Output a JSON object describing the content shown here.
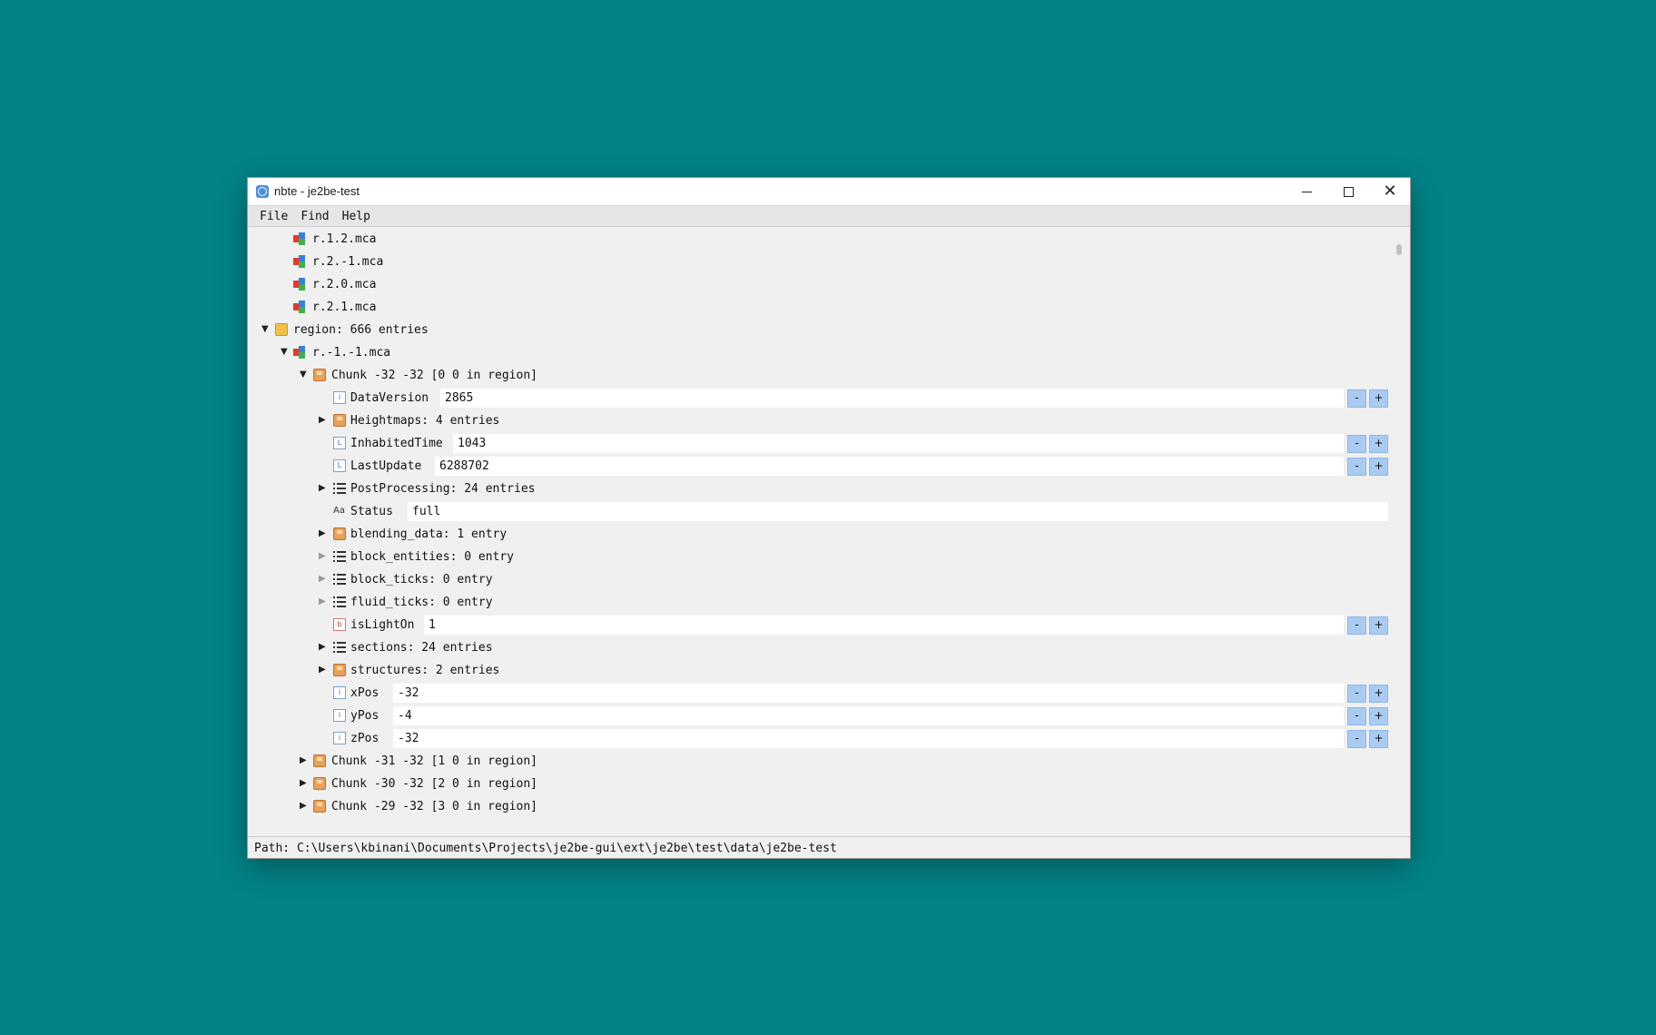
{
  "window": {
    "title": "nbte - je2be-test"
  },
  "menu": {
    "file": "File",
    "find": "Find",
    "help": "Help"
  },
  "tree": {
    "region_files": [
      "r.1.2.mca",
      "r.2.-1.mca",
      "r.2.0.mca",
      "r.2.1.mca"
    ],
    "region_folder": "region: 666 entries",
    "open_region_file": "r.-1.-1.mca",
    "chunk": "Chunk -32 -32 [0 0 in region]",
    "fields": {
      "data_version": {
        "name": "DataVersion",
        "value": "2865"
      },
      "heightmaps": "Heightmaps: 4 entries",
      "inhabited_time": {
        "name": "InhabitedTime",
        "value": "1043"
      },
      "last_update": {
        "name": "LastUpdate",
        "value": "6288702"
      },
      "post_processing": "PostProcessing: 24 entries",
      "status": {
        "name": "Status",
        "value": "full"
      },
      "blending_data": "blending_data: 1 entry",
      "block_entities": "block_entities: 0 entry",
      "block_ticks": "block_ticks: 0 entry",
      "fluid_ticks": "fluid_ticks: 0 entry",
      "is_light_on": {
        "name": "isLightOn",
        "value": "1"
      },
      "sections": "sections: 24 entries",
      "structures": "structures: 2 entries",
      "x_pos": {
        "name": "xPos",
        "value": "-32"
      },
      "y_pos": {
        "name": "yPos",
        "value": "-4"
      },
      "z_pos": {
        "name": "zPos",
        "value": "-32"
      }
    },
    "next_chunks": [
      "Chunk -31 -32 [1 0 in region]",
      "Chunk -30 -32 [2 0 in region]",
      "Chunk -29 -32 [3 0 in region]"
    ],
    "spin_minus": "-",
    "spin_plus": "+"
  },
  "status": {
    "path": "Path: C:\\Users\\kbinani\\Documents\\Projects\\je2be-gui\\ext\\je2be\\test\\data\\je2be-test"
  },
  "icons": {
    "app": "app-icon",
    "region_file": "region-file-icon",
    "folder": "folder-icon",
    "compound": "compound-icon",
    "int": "int-tag-icon",
    "long": "long-tag-icon",
    "byte": "byte-tag-icon",
    "list": "list-icon",
    "string": "string-tag-icon"
  },
  "colors": {
    "desktop": "#038387",
    "spin_button": "#a9cbf2"
  }
}
